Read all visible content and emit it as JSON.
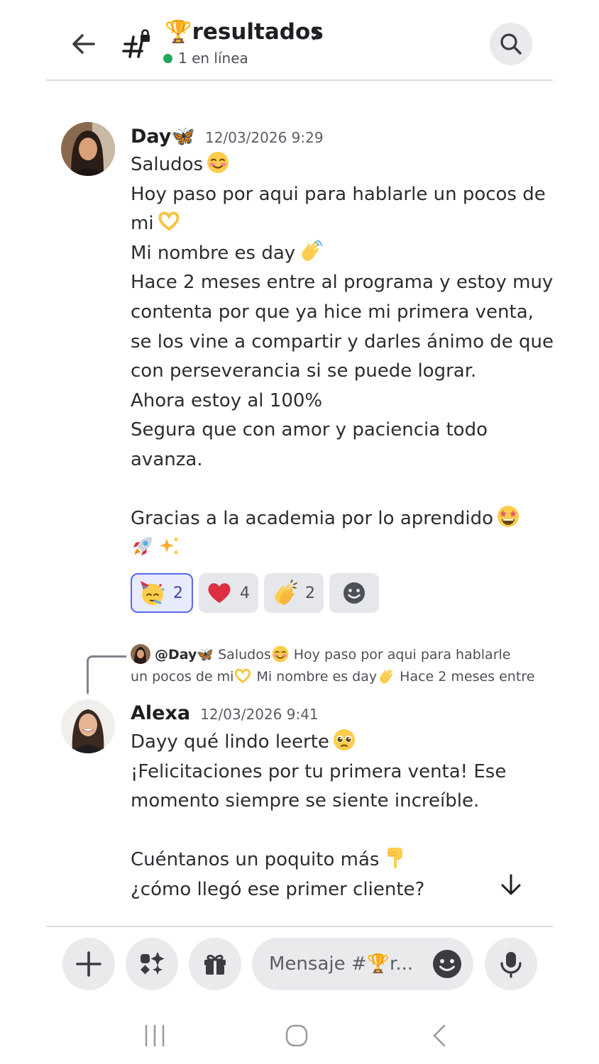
{
  "header": {
    "channel_name": "🏆resultados",
    "online_status": "1 en línea"
  },
  "messages": [
    {
      "author": "Day🦋",
      "timestamp": "12/03/2026 9:29",
      "lines": [
        "Saludos",
        "Hoy paso por aqui para hablarle un pocos de",
        "mi",
        "Mi nombre es day",
        "Hace 2 meses entre al programa y estoy muy",
        "contenta por que ya hice mi primera venta,",
        "se los vine a compartir y darles ánimo de que",
        "con perseverancia si se puede lograr.",
        "Ahora estoy al 100%",
        "Segura que con amor y paciencia todo",
        "avanza.",
        "",
        "Gracias a la academia por lo aprendido",
        ""
      ],
      "reactions": [
        {
          "emoji": "partying-face",
          "count": "2",
          "active": true
        },
        {
          "emoji": "red-heart",
          "count": "4",
          "active": false
        },
        {
          "emoji": "clapping-hands",
          "count": "2",
          "active": false
        }
      ]
    },
    {
      "author": "Alexa",
      "timestamp": "12/03/2026 9:41",
      "reply": {
        "mention": "@Day🦋",
        "line1_a": "Saludos",
        "line1_b": "Hoy paso por aqui para hablarle",
        "line2_a": "un pocos de mi",
        "line2_b": "Mi nombre es day",
        "line2_c": "Hace 2 meses entre"
      },
      "lines": [
        "Dayy qué lindo leerte",
        "¡Felicitaciones por tu primera venta! Ese",
        "momento siempre se siente increíble.",
        "",
        "Cuéntanos un poquito más",
        "¿cómo llegó ese primer cliente?"
      ]
    }
  ],
  "composer": {
    "placeholder": "Mensaje #🏆r..."
  },
  "icons": {
    "back": "arrow-left-icon",
    "channel": "locked-hash-icon",
    "search": "search-icon",
    "plus": "plus-icon",
    "apps": "apps-icon",
    "gift": "gift-icon",
    "emoji": "emoji-icon",
    "mic": "microphone-icon",
    "jump": "arrow-down-icon"
  },
  "colors": {
    "online": "#23a55a",
    "accent": "#5865f2"
  }
}
